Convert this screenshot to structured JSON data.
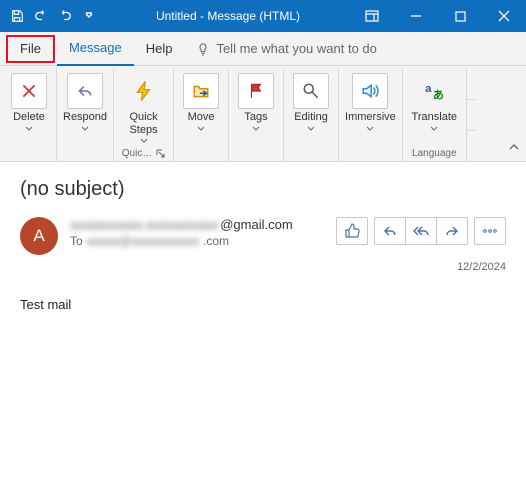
{
  "window": {
    "title": "Untitled  -  Message (HTML)"
  },
  "menu": {
    "file": "File",
    "message": "Message",
    "help": "Help",
    "tellme": "Tell me what you want to do"
  },
  "ribbon": {
    "delete": "Delete",
    "respond": "Respond",
    "quicksteps": "Quick\nSteps",
    "move": "Move",
    "tags": "Tags",
    "editing": "Editing",
    "immersive": "Immersive",
    "translate": "Translate",
    "group_quicksteps": "Quic…",
    "group_language": "Language"
  },
  "mail": {
    "subject": "(no subject)",
    "avatar_initial": "A",
    "from_blurred": "aaaaaaaaaa.aaaaaaaaaa",
    "from_visible": "@gmail.com",
    "to_label": "To",
    "to_blurred": "aaaaa@aaaaaaaaaa",
    "to_visible": ".com",
    "date": "12/2/2024",
    "body": "Test mail"
  }
}
